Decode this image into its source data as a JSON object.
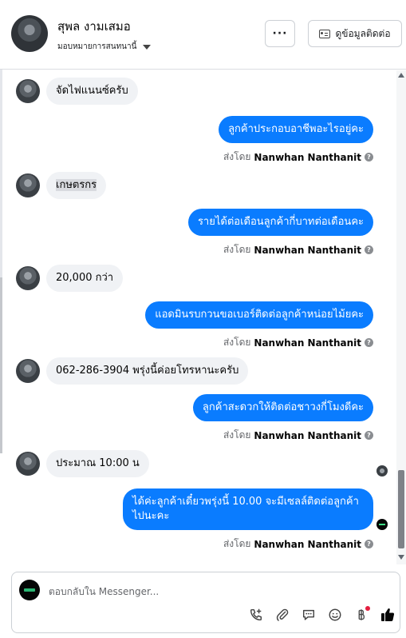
{
  "header": {
    "contact_name": "สุพล งามเสมอ",
    "assign_label": "มอบหมายการสนทนานี้",
    "more_label": "···",
    "contact_info_label": "ดูข้อมูลติดต่อ"
  },
  "messages": [
    {
      "direction": "in",
      "text": "จัดไฟแนนซ์ครับ"
    },
    {
      "direction": "out",
      "text": "ลูกค้าประกอบอาชีพอะไรอยู่คะ",
      "sent_by_prefix": "ส่งโดย",
      "sender": "Nanwhan Nanthanit"
    },
    {
      "direction": "in",
      "text": "เกษตรกร"
    },
    {
      "direction": "out",
      "text": "รายได้ต่อเดือนลูกค้ากี่บาทต่อเดือนคะ",
      "sent_by_prefix": "ส่งโดย",
      "sender": "Nanwhan Nanthanit"
    },
    {
      "direction": "in",
      "text": "20,000 กว่า"
    },
    {
      "direction": "out",
      "text": "แอดมินรบกวนขอเบอร์ติดต่อลูกค้าหน่อยไม้ยคะ",
      "sent_by_prefix": "ส่งโดย",
      "sender": "Nanwhan Nanthanit"
    },
    {
      "direction": "in",
      "text": "062-286-3904 พรุ่งนี้ค่อยโทรหานะครับ"
    },
    {
      "direction": "out",
      "text": "ลูกค้าสะดวกให้ติดต่อชาวงกี่โมงดีคะ",
      "sent_by_prefix": "ส่งโดย",
      "sender": "Nanwhan Nanthanit"
    },
    {
      "direction": "in",
      "text": "ประมาณ 10:00 น"
    },
    {
      "direction": "out",
      "text": "ได้ค่ะลูกค้าเดี๋ยวพรุ่งนี้ 10.00 จะมีเซลล์ติดต่อลูกค้าไปนะคะ",
      "sent_by_prefix": "ส่งโดย",
      "sender": "Nanwhan Nanthanit"
    }
  ],
  "composer": {
    "placeholder": "ตอบกลับใน Messenger..."
  },
  "icons": [
    "phone-plus-icon",
    "paperclip-icon",
    "chat-bubble-icon",
    "smiley-icon",
    "baht-icon",
    "thumbs-up-icon",
    "more-dots-icon",
    "id-card-icon",
    "caret-down-icon",
    "help-icon"
  ],
  "colors": {
    "outgoing_bubble": "#0a7cff",
    "incoming_bubble": "#f0f2f5",
    "thumbs_up": "#050505"
  }
}
